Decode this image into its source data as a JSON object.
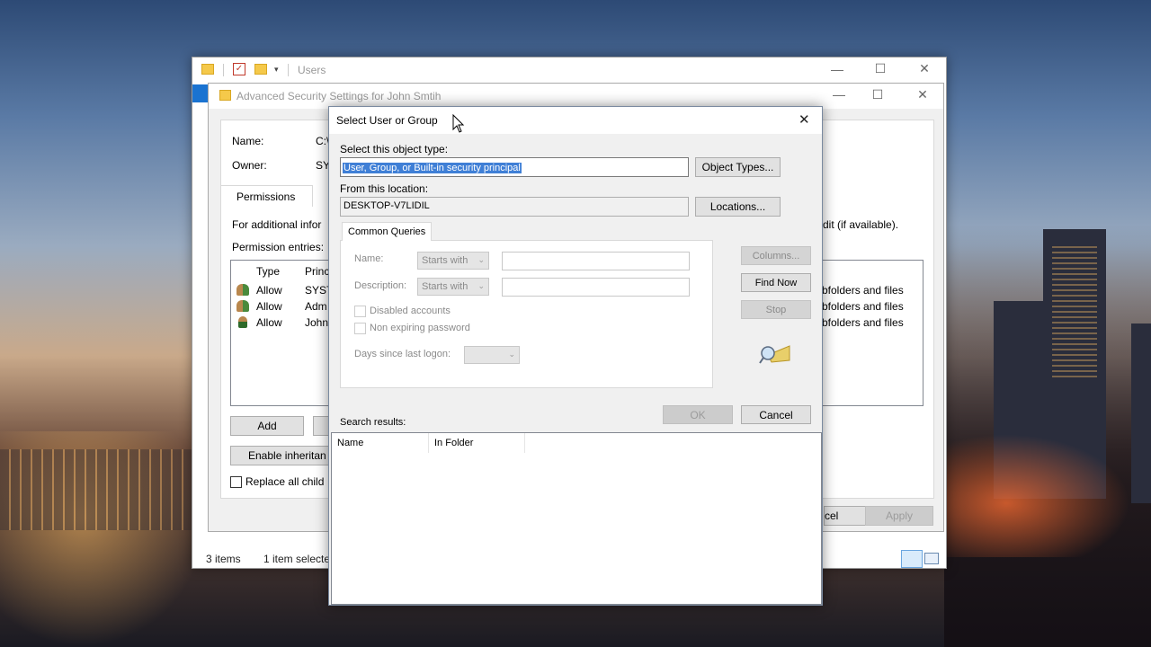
{
  "explorer": {
    "title": "Users",
    "status_items": "3 items",
    "status_selected": "1 item selecte"
  },
  "advanced": {
    "title": "Advanced Security Settings for John Smtih",
    "name_label": "Name:",
    "name_value": "C:\\",
    "owner_label": "Owner:",
    "owner_value": "SY",
    "tab_permissions": "Permissions",
    "info_text": "For additional infor",
    "info_text_right": "dit (if available).",
    "entries_label": "Permission entries:",
    "col_type": "Type",
    "col_principal": "Princ",
    "rows": [
      {
        "type": "Allow",
        "principal": "SYST",
        "applies": "bfolders and files"
      },
      {
        "type": "Allow",
        "principal": "Adm",
        "applies": "bfolders and files"
      },
      {
        "type": "Allow",
        "principal": "John",
        "applies": "bfolders and files"
      }
    ],
    "add_button": "Add",
    "enable_inheritance": "Enable inheritan",
    "replace_child": "Replace all child",
    "cancel_partial": "cel",
    "apply_button": "Apply"
  },
  "dialog": {
    "title": "Select User or Group",
    "object_type_label": "Select this object type:",
    "object_type_value": "User, Group, or Built-in security principal",
    "object_types_button": "Object Types...",
    "location_label": "From this location:",
    "location_value": "DESKTOP-V7LIDIL",
    "locations_button": "Locations...",
    "tab_common_queries": "Common Queries",
    "name_label": "Name:",
    "name_combo": "Starts with",
    "description_label": "Description:",
    "description_combo": "Starts with",
    "disabled_accounts": "Disabled accounts",
    "non_expiring_password": "Non expiring password",
    "days_since_logon": "Days since last logon:",
    "columns_button": "Columns...",
    "find_now_button": "Find Now",
    "stop_button": "Stop",
    "search_results_label": "Search results:",
    "ok_button": "OK",
    "cancel_button": "Cancel",
    "results_columns": [
      "Name",
      "In Folder"
    ]
  }
}
